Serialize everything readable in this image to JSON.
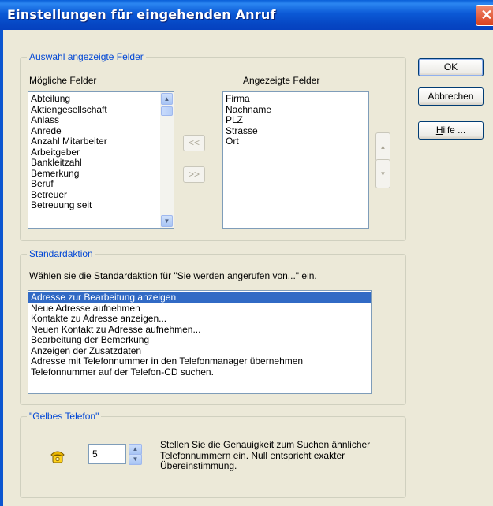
{
  "window": {
    "title": "Einstellungen für eingehenden Anruf",
    "close_glyph": "✕"
  },
  "fields_group": {
    "title": "Auswahl angezeigte Felder",
    "possible_label": "Mögliche Felder",
    "displayed_label": "Angezeigte Felder",
    "possible_items": [
      "Abteilung",
      "Aktiengesellschaft",
      "Anlass",
      "Anrede",
      "Anzahl Mitarbeiter",
      "Arbeitgeber",
      "Bankleitzahl",
      "Bemerkung",
      "Beruf",
      "Betreuer",
      "Betreuung seit"
    ],
    "displayed_items": [
      "Firma",
      "Nachname",
      "PLZ",
      "Strasse",
      "Ort"
    ],
    "move_left_label": "<<",
    "move_right_label": ">>"
  },
  "buttons": {
    "ok": "OK",
    "cancel": "Abbrechen",
    "help_mnemonic": "H",
    "help_rest": "ilfe ..."
  },
  "default_action_group": {
    "title": "Standardaktion",
    "prompt": "Wählen sie die Standardaktion für \"Sie werden angerufen von...\" ein.",
    "items": [
      "Adresse zur Bearbeitung anzeigen",
      "Neue Adresse aufnehmen",
      "Kontakte zu Adresse anzeigen...",
      "Neuen Kontakt zu Adresse aufnehmen...",
      "Bearbeitung der Bemerkung",
      "Anzeigen der Zusatzdaten",
      "Adresse mit Telefonnummer in den Telefonmanager übernehmen",
      "Telefonnummer auf der Telefon-CD suchen."
    ],
    "selected_index": 0
  },
  "yellow_phone_group": {
    "title": "\"Gelbes Telefon\"",
    "value": "5",
    "description_lines": [
      "Stellen Sie die Genauigkeit zum Suchen ähnlicher",
      "Telefonnummern ein. Null entspricht exakter",
      "Übereinstimmung."
    ]
  }
}
